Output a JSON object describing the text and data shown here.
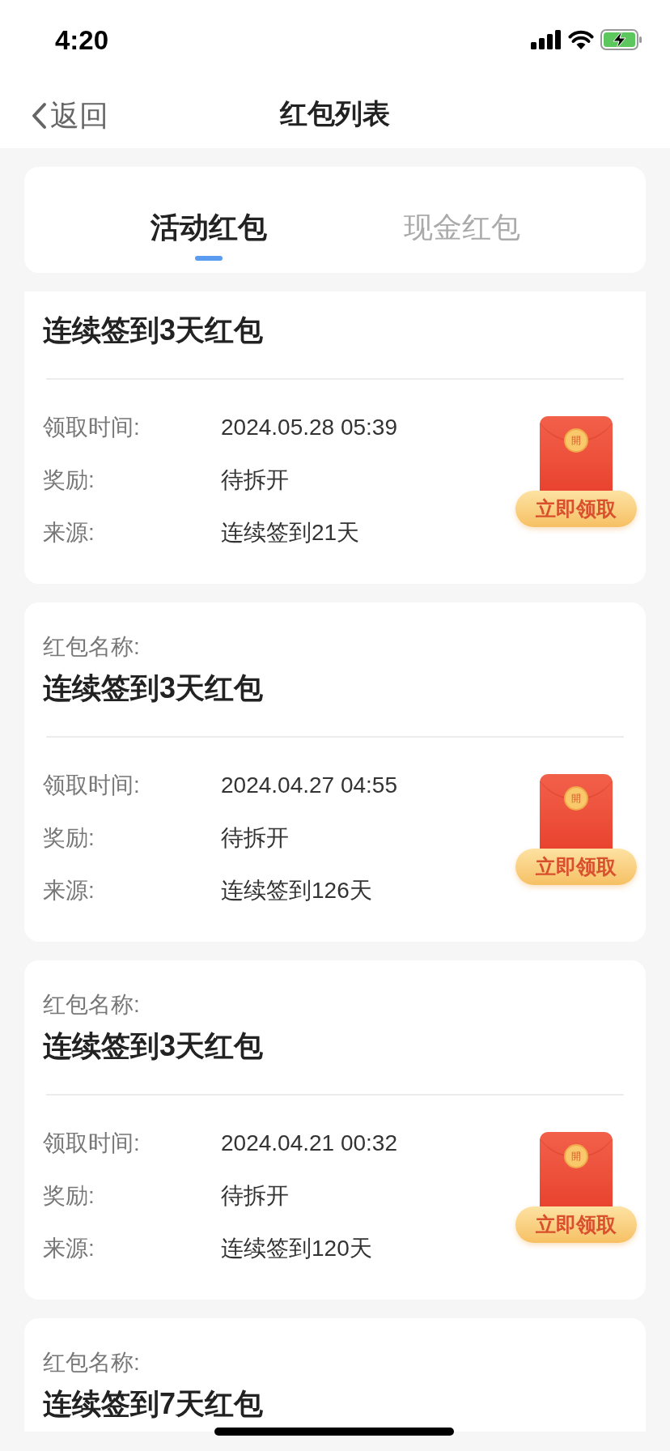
{
  "status_bar": {
    "time": "4:20"
  },
  "nav": {
    "back": "返回",
    "title": "红包列表"
  },
  "tabs": [
    {
      "label": "活动红包",
      "selected": true
    },
    {
      "label": "现金红包",
      "selected": false
    }
  ],
  "cards": [
    {
      "title": "连续签到3天红包",
      "rows": [
        {
          "label": "领取时间:",
          "value": "2024.05.28 05:39"
        },
        {
          "label": "奖励:",
          "value": "待拆开"
        },
        {
          "label": "来源:",
          "value": "连续签到21天"
        }
      ],
      "claim": {
        "seal": "開",
        "button": "立即领取"
      }
    },
    {
      "name_label": "红包名称:",
      "title": "连续签到3天红包",
      "rows": [
        {
          "label": "领取时间:",
          "value": "2024.04.27 04:55"
        },
        {
          "label": "奖励:",
          "value": "待拆开"
        },
        {
          "label": "来源:",
          "value": "连续签到126天"
        }
      ],
      "claim": {
        "seal": "開",
        "button": "立即领取"
      }
    },
    {
      "name_label": "红包名称:",
      "title": "连续签到3天红包",
      "rows": [
        {
          "label": "领取时间:",
          "value": "2024.04.21 00:32"
        },
        {
          "label": "奖励:",
          "value": "待拆开"
        },
        {
          "label": "来源:",
          "value": "连续签到120天"
        }
      ],
      "claim": {
        "seal": "開",
        "button": "立即领取"
      }
    },
    {
      "name_label": "红包名称:",
      "title": "连续签到7天红包"
    }
  ]
}
